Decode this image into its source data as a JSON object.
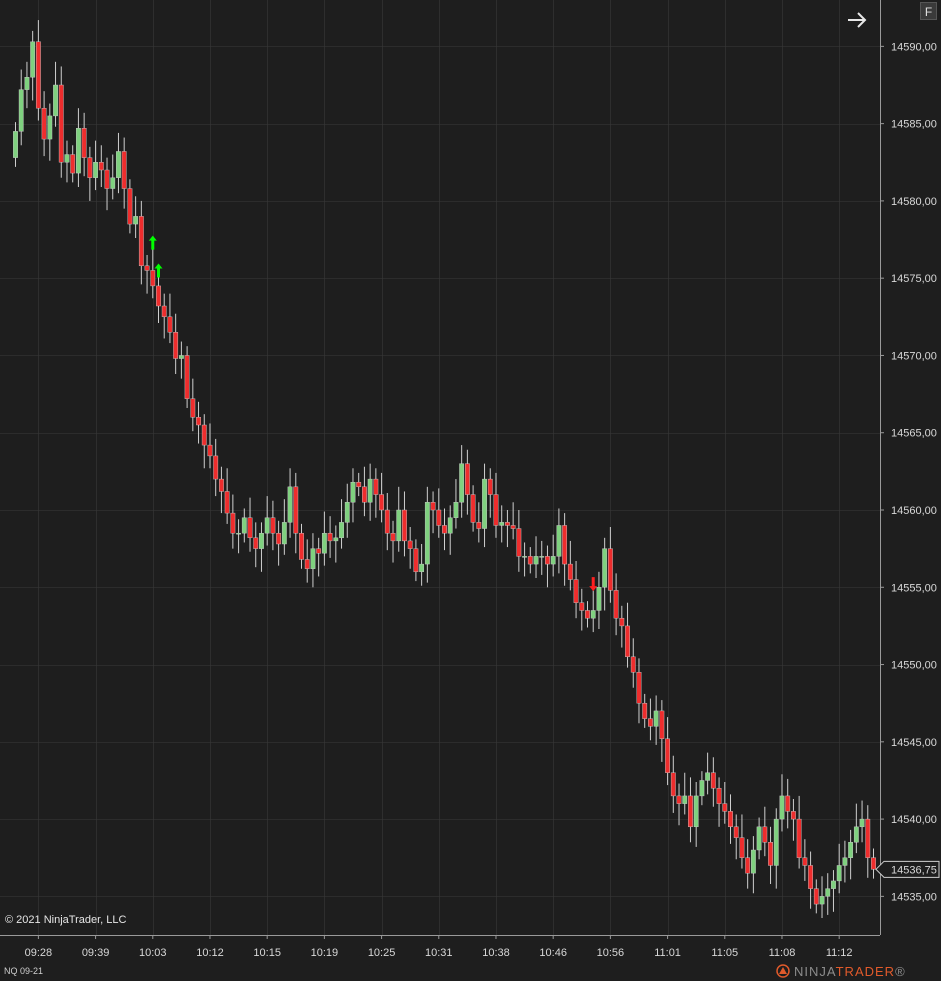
{
  "copyright": "© 2021 NinjaTrader, LLC",
  "instrument": "NQ 09-21",
  "brand": {
    "prefix": "NINJA",
    "accent": "TRADER",
    "suffix": "®"
  },
  "top_right_button": "F",
  "icons": {
    "scroll": "arrow-right-icon",
    "logo": "ninjatrader-logo-icon"
  },
  "colors": {
    "background": "#1e1e1e",
    "up": "#7fd17f",
    "down": "#ee2d2d",
    "grid": "#3a3a3a",
    "signal_long": "#00ff00",
    "signal_short": "#ff2020"
  },
  "chart_data": {
    "type": "candlestick",
    "instrument": "NQ 09-21",
    "ylim": [
      14532.5,
      14593.0
    ],
    "y_ticks": [
      14590,
      14585,
      14580,
      14575,
      14570,
      14565,
      14560,
      14555,
      14550,
      14545,
      14540,
      14535
    ],
    "y_tick_labels": [
      "14590,00",
      "14585,00",
      "14580,00",
      "14575,00",
      "14570,00",
      "14565,00",
      "14560,00",
      "14555,00",
      "14550,00",
      "14545,00",
      "14540,00",
      "14535,00"
    ],
    "x_tick_labels": [
      "09:28",
      "09:39",
      "10:03",
      "10:12",
      "10:15",
      "10:19",
      "10:25",
      "10:31",
      "10:38",
      "10:46",
      "10:56",
      "11:01",
      "11:05",
      "11:08",
      "11:12"
    ],
    "x_tick_bar_index": [
      4,
      14,
      24,
      34,
      44,
      54,
      64,
      74,
      84,
      94,
      104,
      114,
      124,
      134,
      144
    ],
    "last_price": 14536.75,
    "last_price_label": "14536,75",
    "grid": true,
    "close": [
      14584.5,
      14587.2,
      14588,
      14590.3,
      14586,
      14584,
      14585.5,
      14587.5,
      14582.5,
      14583,
      14581.8,
      14584.7,
      14582.8,
      14581.5,
      14582.5,
      14582,
      14580.8,
      14581.5,
      14583.2,
      14580.8,
      14578.5,
      14579,
      14575.8,
      14575.5,
      14574.5,
      14573.2,
      14572.5,
      14571.5,
      14569.8,
      14570,
      14567.2,
      14566,
      14565.5,
      14564.2,
      14563.5,
      14562,
      14561.2,
      14559.8,
      14558.5,
      14558.5,
      14559.5,
      14558.2,
      14557.5,
      14558.5,
      14559.5,
      14558.5,
      14557.8,
      14559.2,
      14561.5,
      14558.5,
      14556.8,
      14556.2,
      14557.5,
      14557.2,
      14558.5,
      14558,
      14558.2,
      14559.2,
      14560.5,
      14561.8,
      14561.5,
      14560.5,
      14562,
      14561,
      14560,
      14558.5,
      14558,
      14560,
      14558,
      14557.5,
      14556,
      14556.5,
      14560.5,
      14560,
      14559,
      14558.5,
      14559.5,
      14560.5,
      14563,
      14561,
      14559.2,
      14558.8,
      14562,
      14561,
      14559,
      14559.2,
      14559,
      14558.8,
      14557,
      14557,
      14556.5,
      14557,
      14557,
      14556.5,
      14557,
      14559,
      14556.5,
      14555.5,
      14554,
      14553.5,
      14553,
      14553.5,
      14555,
      14557.5,
      14554.8,
      14553,
      14552.5,
      14550.5,
      14549.5,
      14547.5,
      14546.5,
      14546,
      14547,
      14545.2,
      14543,
      14541.5,
      14541,
      14541.5,
      14539.5,
      14541.5,
      14542.5,
      14543,
      14542,
      14541,
      14540.5,
      14539.5,
      14538.8,
      14537.5,
      14536.5,
      14538,
      14539.5,
      14538.5,
      14537,
      14540,
      14541.5,
      14540.5,
      14540,
      14537.5,
      14537,
      14535.5,
      14534.5,
      14535,
      14535.5,
      14536,
      14537,
      14537.5,
      14538.5,
      14539.5,
      14540,
      14537.5,
      14536.75
    ],
    "signals": [
      {
        "type": "long",
        "bar_index": 24,
        "price": 14577.3
      },
      {
        "type": "long",
        "bar_index": 25,
        "price": 14575.5
      },
      {
        "type": "short",
        "bar_index": 101,
        "price": 14555.2
      }
    ]
  }
}
